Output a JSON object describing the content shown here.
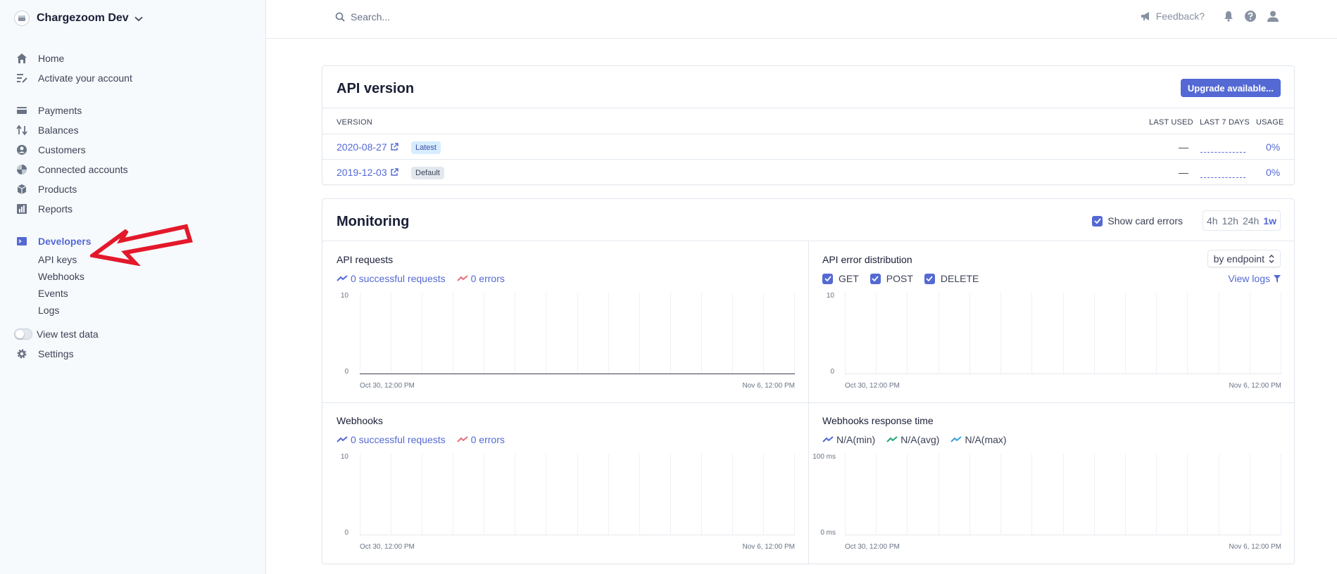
{
  "sidebar": {
    "account_name": "Chargezoom Dev",
    "nav": [
      {
        "label": "Home",
        "icon": "home-icon"
      },
      {
        "label": "Activate your account",
        "icon": "checklist-icon"
      },
      {
        "label": "Payments",
        "icon": "payments-icon"
      },
      {
        "label": "Balances",
        "icon": "balances-icon"
      },
      {
        "label": "Customers",
        "icon": "customers-icon"
      },
      {
        "label": "Connected accounts",
        "icon": "connected-accounts-icon"
      },
      {
        "label": "Products",
        "icon": "products-icon"
      },
      {
        "label": "Reports",
        "icon": "reports-icon"
      },
      {
        "label": "Developers",
        "icon": "terminal-icon"
      }
    ],
    "developers_sub": [
      "API keys",
      "Webhooks",
      "Events",
      "Logs"
    ],
    "view_test_data": "View test data",
    "settings": "Settings"
  },
  "topbar": {
    "search_placeholder": "Search...",
    "feedback": "Feedback?"
  },
  "api_version": {
    "title": "API version",
    "upgrade_button": "Upgrade available...",
    "columns": {
      "version": "VERSION",
      "last_used": "LAST USED",
      "last_7_days": "LAST 7 DAYS",
      "usage": "USAGE"
    },
    "rows": [
      {
        "version": "2020-08-27",
        "badge": "Latest",
        "last_used": "—",
        "usage": "0%"
      },
      {
        "version": "2019-12-03",
        "badge": "Default",
        "last_used": "—",
        "usage": "0%"
      }
    ]
  },
  "monitoring": {
    "title": "Monitoring",
    "show_card_errors": "Show card errors",
    "ranges": [
      "4h",
      "12h",
      "24h",
      "1w"
    ],
    "selected_range": "1w",
    "panels": {
      "api_requests": {
        "title": "API requests",
        "legend": [
          "0 successful requests",
          "0 errors"
        ],
        "y_top": "10",
        "y_bottom": "0",
        "x_start": "Oct 30, 12:00 PM",
        "x_end": "Nov 6, 12:00 PM"
      },
      "api_error_distribution": {
        "title": "API error distribution",
        "select": "by endpoint",
        "view_logs": "View logs",
        "methods": [
          "GET",
          "POST",
          "DELETE"
        ],
        "y_top": "10",
        "y_bottom": "0",
        "x_start": "Oct 30, 12:00 PM",
        "x_end": "Nov 6, 12:00 PM"
      },
      "webhooks": {
        "title": "Webhooks",
        "legend": [
          "0 successful requests",
          "0 errors"
        ],
        "y_top": "10",
        "y_bottom": "0",
        "x_start": "Oct 30, 12:00 PM",
        "x_end": "Nov 6, 12:00 PM"
      },
      "webhooks_response_time": {
        "title": "Webhooks response time",
        "legend": [
          "N/A(min)",
          "N/A(avg)",
          "N/A(max)"
        ],
        "y_top": "100 ms",
        "y_bottom": "0 ms",
        "x_start": "Oct 30, 12:00 PM",
        "x_end": "Nov 6, 12:00 PM"
      }
    }
  },
  "colors": {
    "accent": "#5469d4",
    "error": "#e56f7f",
    "avg": "#1ea672",
    "max": "#3d9fd6",
    "annotation_arrow": "#e3192b"
  }
}
